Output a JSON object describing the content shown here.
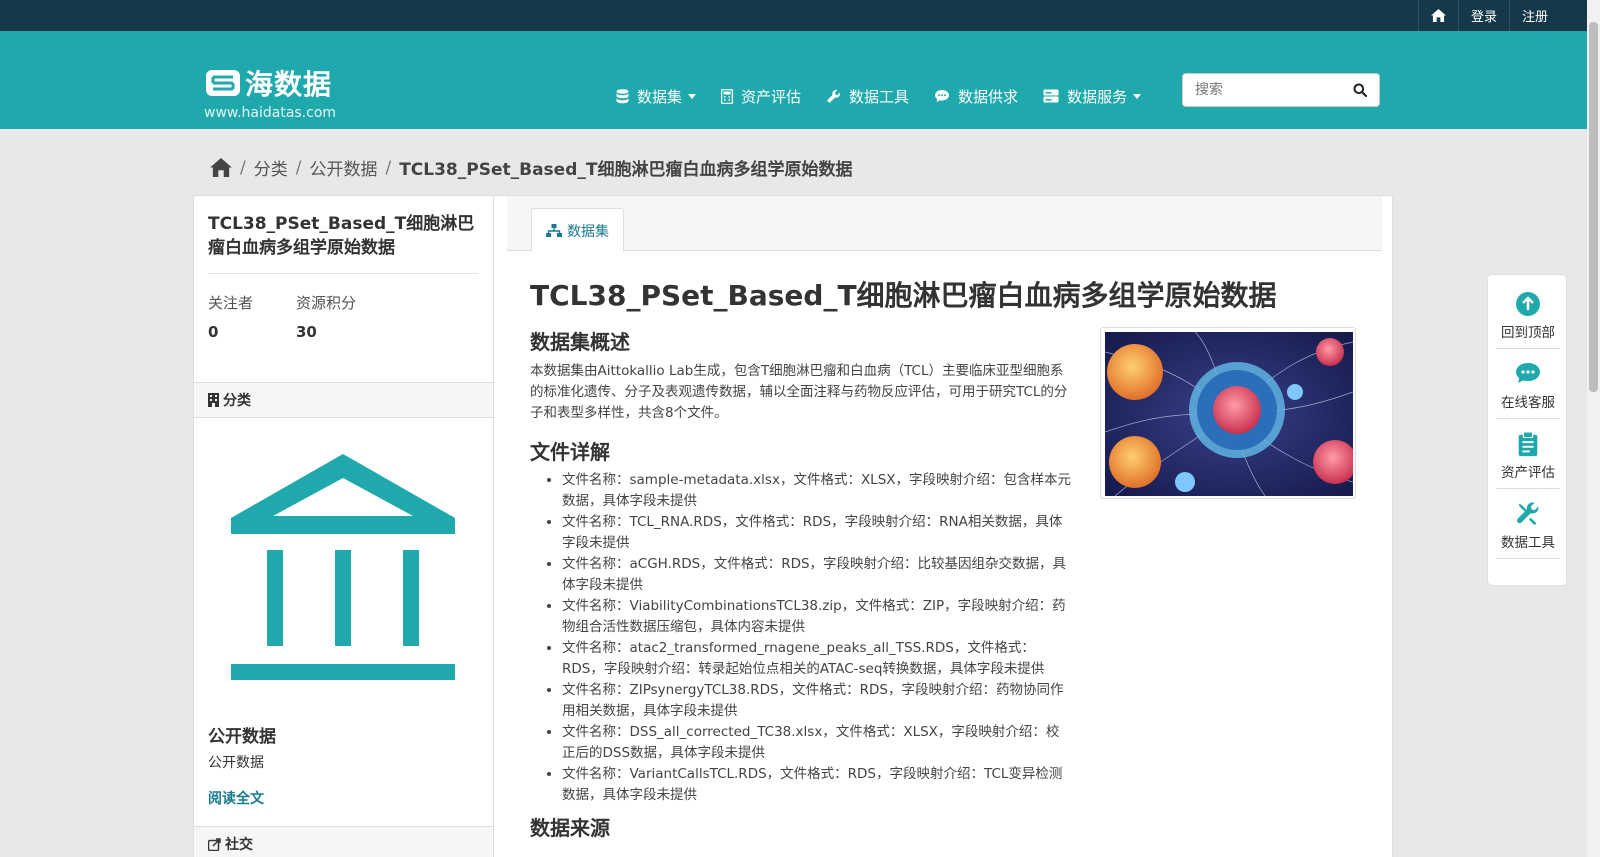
{
  "topnav": {
    "home_icon": "home-icon",
    "login": "登录",
    "register": "注册"
  },
  "brand": {
    "name": "海数据",
    "url": "www.haidatas.com"
  },
  "mainnav": [
    {
      "label": "数据集",
      "icon": "database-icon",
      "dropdown": true
    },
    {
      "label": "资产评估",
      "icon": "calculator-icon",
      "dropdown": false
    },
    {
      "label": "数据工具",
      "icon": "wrench-icon",
      "dropdown": false
    },
    {
      "label": "数据供求",
      "icon": "comment-icon",
      "dropdown": false
    },
    {
      "label": "数据服务",
      "icon": "server-icon",
      "dropdown": true
    }
  ],
  "search": {
    "placeholder": "搜索"
  },
  "breadcrumb": {
    "home_icon": "home-icon",
    "level1": "分类",
    "level2": "公开数据",
    "current": "TCL38_PSet_Based_T细胞淋巴瘤白血病多组学原始数据"
  },
  "sidebar": {
    "title": "TCL38_PSet_Based_T细胞淋巴瘤白血病多组学原始数据",
    "followers_label": "关注者",
    "followers_value": "0",
    "points_label": "资源积分",
    "points_value": "30",
    "category_heading": "分类",
    "category_name": "公开数据",
    "category_desc": "公开数据",
    "read_more": "阅读全文",
    "social_heading": "社交"
  },
  "main": {
    "tab_label": "数据集",
    "title": "TCL38_PSet_Based_T细胞淋巴瘤白血病多组学原始数据",
    "overview_heading": "数据集概述",
    "overview_text": "本数据集由Aittokallio Lab生成，包含T细胞淋巴瘤和白血病（TCL）主要临床亚型细胞系的标准化遗传、分子及表观遗传数据，辅以全面注释与药物反应评估，可用于研究TCL的分子和表型多样性，共含8个文件。",
    "files_heading": "文件详解",
    "files": [
      "文件名称：sample-metadata.xlsx，文件格式：XLSX，字段映射介绍：包含样本元数据，具体字段未提供",
      "文件名称：TCL_RNA.RDS，文件格式：RDS，字段映射介绍：RNA相关数据，具体字段未提供",
      "文件名称：aCGH.RDS，文件格式：RDS，字段映射介绍：比较基因组杂交数据，具体字段未提供",
      "文件名称：ViabilityCombinationsTCL38.zip，文件格式：ZIP，字段映射介绍：药物组合活性数据压缩包，具体内容未提供",
      "文件名称：atac2_transformed_rnagene_peaks_all_TSS.RDS，文件格式：RDS，字段映射介绍：转录起始位点相关的ATAC-seq转换数据，具体字段未提供",
      "文件名称：ZIPsynergyTCL38.RDS，文件格式：RDS，字段映射介绍：药物协同作用相关数据，具体字段未提供",
      "文件名称：DSS_all_corrected_TC38.xlsx，文件格式：XLSX，字段映射介绍：校正后的DSS数据，具体字段未提供",
      "文件名称：VariantCallsTCL.RDS，文件格式：RDS，字段映射介绍：TCL变异检测数据，具体字段未提供"
    ],
    "source_heading": "数据来源"
  },
  "floating": [
    {
      "label": "回到顶部",
      "icon": "arrow-up-circle-icon"
    },
    {
      "label": "在线客服",
      "icon": "chat-icon"
    },
    {
      "label": "资产评估",
      "icon": "clipboard-icon"
    },
    {
      "label": "数据工具",
      "icon": "tools-icon"
    }
  ],
  "colors": {
    "brand": "#1fa9ac",
    "topbar": "#16394a",
    "link": "#187b8f"
  }
}
